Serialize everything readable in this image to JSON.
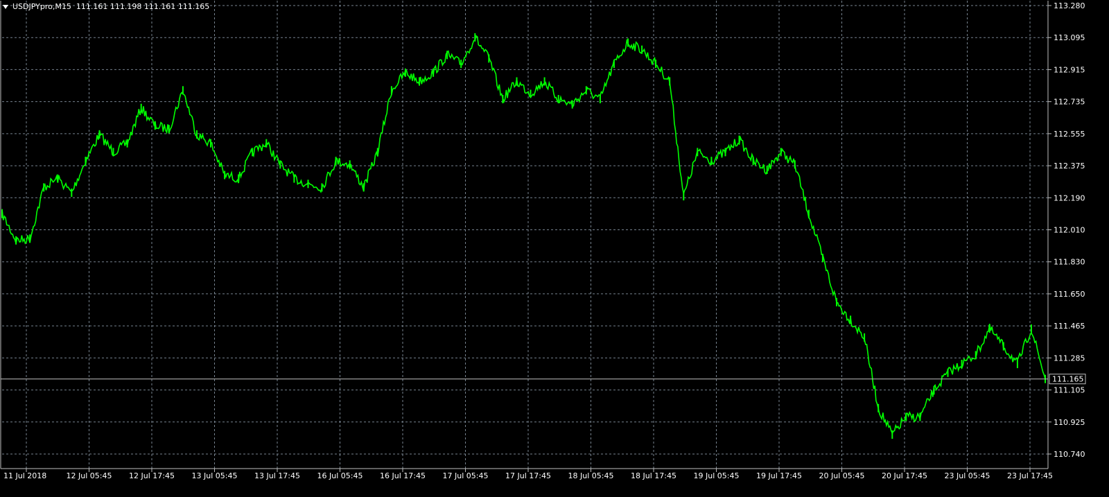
{
  "chart_header": {
    "symbol_label": "USDJPYpro,M15",
    "ohlc_text": "111.161 111.198 111.161 111.165"
  },
  "colors": {
    "background": "#000000",
    "grid": "#8c9aa8",
    "series": "#00ff00",
    "axis_text": "#ffffff",
    "price_line": "#c0c0c0"
  },
  "chart_data": {
    "type": "line",
    "title": "",
    "xlabel": "",
    "ylabel": "",
    "grid": true,
    "ylim": [
      110.74,
      113.28
    ],
    "y_ticks": [
      "113.280",
      "113.095",
      "112.915",
      "112.735",
      "112.555",
      "112.375",
      "112.190",
      "112.010",
      "111.830",
      "111.650",
      "111.465",
      "111.285",
      "111.105",
      "110.925",
      "110.740"
    ],
    "x_ticks": [
      "11 Jul 2018",
      "12 Jul 05:45",
      "12 Jul 17:45",
      "13 Jul 05:45",
      "13 Jul 17:45",
      "16 Jul 05:45",
      "16 Jul 17:45",
      "17 Jul 05:45",
      "17 Jul 17:45",
      "18 Jul 05:45",
      "18 Jul 17:45",
      "19 Jul 05:45",
      "19 Jul 17:45",
      "20 Jul 05:45",
      "20 Jul 17:45",
      "23 Jul 05:45",
      "23 Jul 17:45"
    ],
    "current_price": "111.165",
    "series": [
      {
        "x": [
          "11 Jul 2018",
          "11 Jul 2018",
          "11 Jul 2018",
          "12 Jul 05:45",
          "12 Jul 05:45",
          "12 Jul 05:45",
          "12 Jul 05:45",
          "12 Jul 05:45",
          "12 Jul 17:45",
          "12 Jul 17:45",
          "12 Jul 17:45",
          "12 Jul 17:45",
          "12 Jul 17:45",
          "13 Jul 05:45",
          "13 Jul 05:45",
          "13 Jul 05:45",
          "13 Jul 17:45",
          "13 Jul 17:45",
          "13 Jul 17:45",
          "13 Jul 17:45",
          "16 Jul 05:45",
          "16 Jul 05:45",
          "16 Jul 05:45",
          "16 Jul 17:45",
          "16 Jul 17:45",
          "16 Jul 17:45",
          "16 Jul 17:45",
          "17 Jul 05:45",
          "17 Jul 05:45",
          "17 Jul 05:45",
          "17 Jul 05:45",
          "17 Jul 17:45",
          "17 Jul 17:45",
          "17 Jul 17:45",
          "18 Jul 05:45",
          "18 Jul 05:45",
          "18 Jul 05:45",
          "18 Jul 05:45",
          "18 Jul 05:45",
          "18 Jul 17:45",
          "18 Jul 17:45",
          "18 Jul 17:45",
          "18 Jul 17:45",
          "18 Jul 17:45",
          "19 Jul 05:45",
          "19 Jul 05:45",
          "19 Jul 05:45",
          "19 Jul 05:45",
          "19 Jul 05:45",
          "19 Jul 05:45",
          "19 Jul 05:45",
          "19 Jul 17:45",
          "19 Jul 17:45",
          "19 Jul 17:45",
          "19 Jul 17:45",
          "20 Jul 05:45",
          "20 Jul 05:45",
          "20 Jul 05:45",
          "20 Jul 05:45",
          "20 Jul 05:45",
          "20 Jul 05:45",
          "20 Jul 17:45",
          "20 Jul 17:45",
          "20 Jul 17:45",
          "20 Jul 17:45",
          "20 Jul 17:45",
          "20 Jul 17:45",
          "23 Jul 05:45",
          "23 Jul 05:45",
          "23 Jul 05:45",
          "23 Jul 05:45",
          "23 Jul 17:45",
          "23 Jul 17:45",
          "23 Jul 17:45",
          "23 Jul 17:45",
          "23 Jul 17:45"
        ],
        "values": [
          112.1,
          111.95,
          111.96,
          112.25,
          112.3,
          112.22,
          112.4,
          112.55,
          112.45,
          112.5,
          112.7,
          112.6,
          112.58,
          112.8,
          112.55,
          112.5,
          112.32,
          112.3,
          112.45,
          112.5,
          112.38,
          112.3,
          112.27,
          112.25,
          112.4,
          112.38,
          112.25,
          112.45,
          112.8,
          112.9,
          112.85,
          112.9,
          113.0,
          112.95,
          113.1,
          112.98,
          112.75,
          112.85,
          112.78,
          112.85,
          112.75,
          112.72,
          112.8,
          112.75,
          112.95,
          113.07,
          113.03,
          112.95,
          112.85,
          112.2,
          112.45,
          112.4,
          112.45,
          112.52,
          112.4,
          112.35,
          112.45,
          112.38,
          112.1,
          111.85,
          111.6,
          111.5,
          111.4,
          111.0,
          110.85,
          110.95,
          110.95,
          111.1,
          111.2,
          111.25,
          111.3,
          111.45,
          111.35,
          111.25,
          111.45,
          111.165
        ]
      }
    ]
  }
}
